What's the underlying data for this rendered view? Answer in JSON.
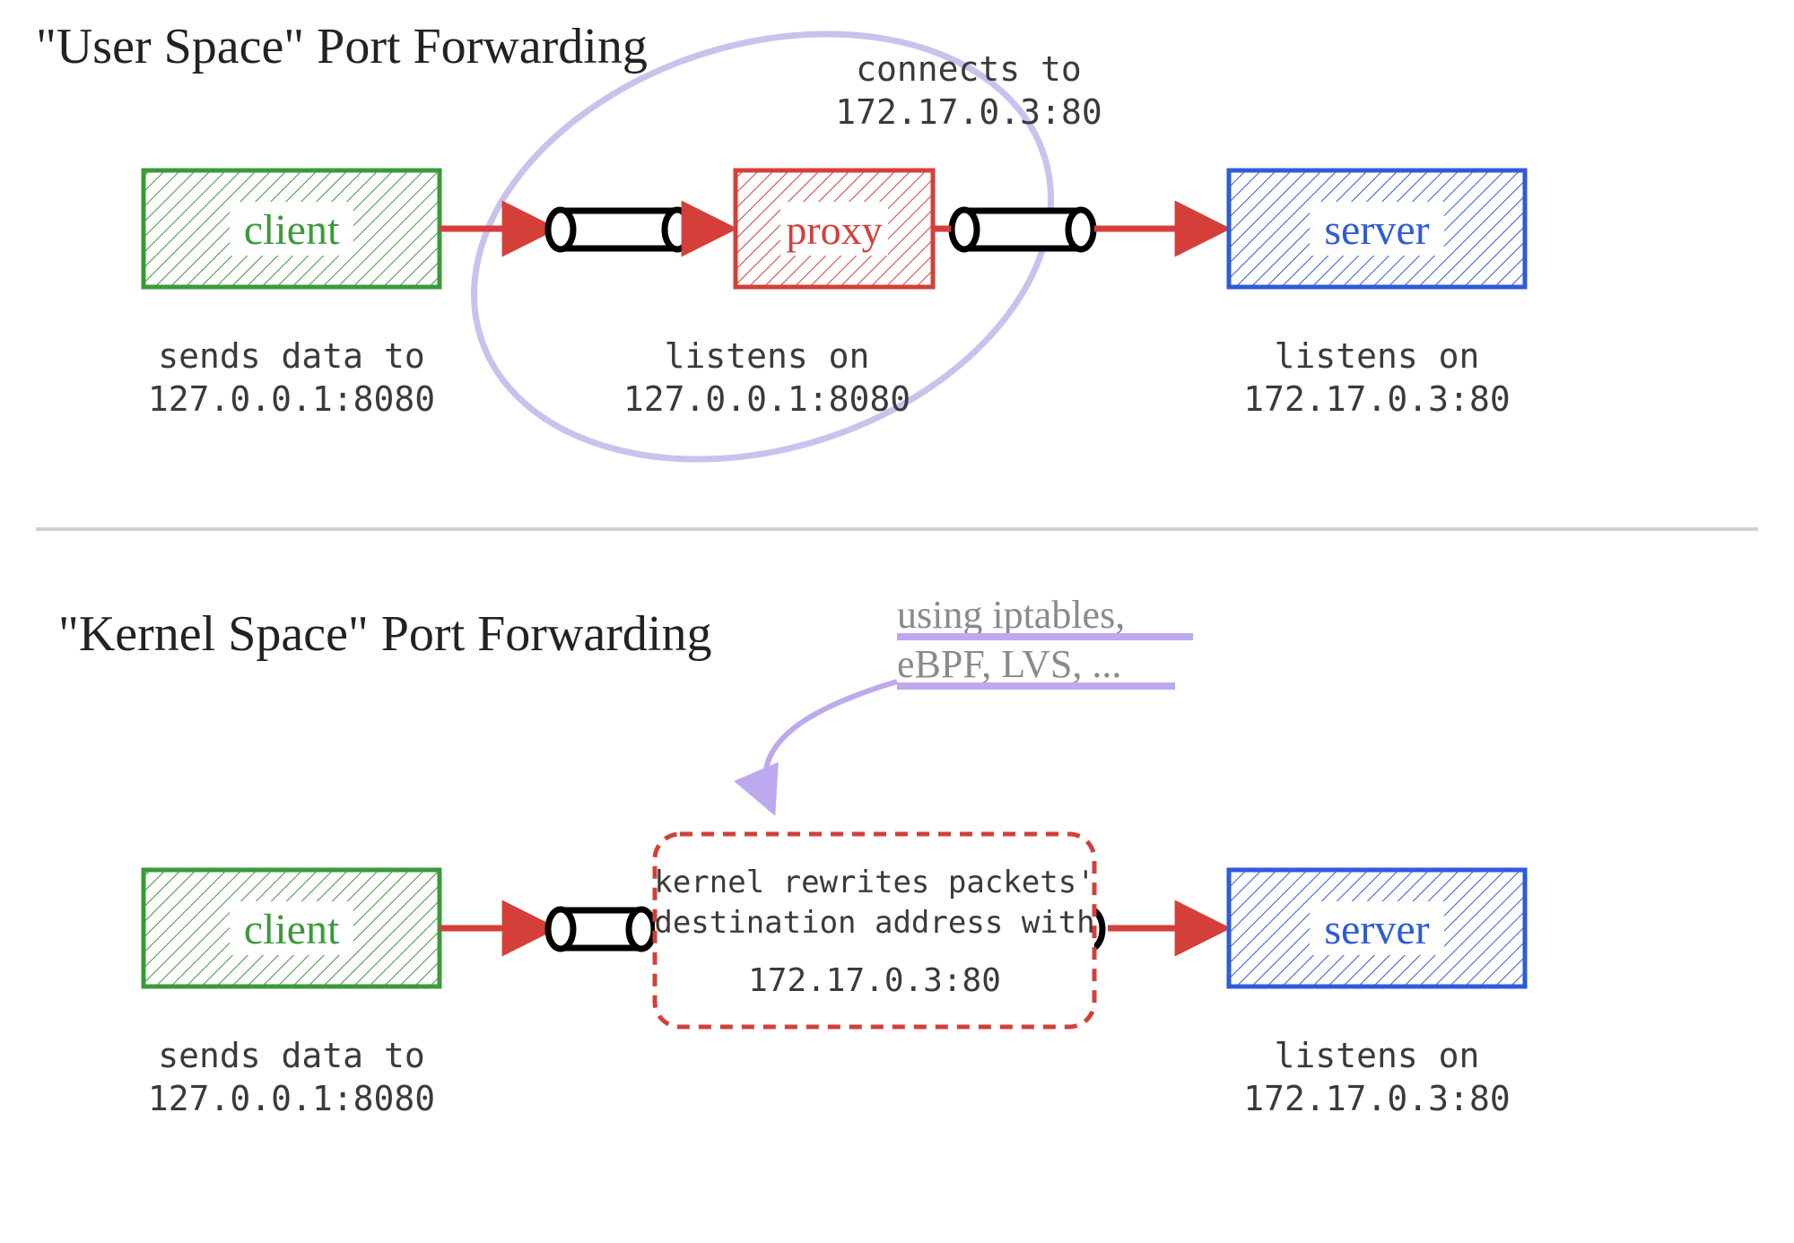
{
  "title_top": "\"User Space\" Port Forwarding",
  "title_bottom": "\"Kernel Space\" Port Forwarding",
  "client": {
    "label": "client",
    "sub1": "sends data to",
    "sub2": "127.0.0.1:8080"
  },
  "proxy": {
    "label": "proxy",
    "listens1": "listens on",
    "listens2": "127.0.0.1:8080",
    "connects1": "connects to",
    "connects2": "172.17.0.3:80"
  },
  "server": {
    "label": "server",
    "listens1": "listens on",
    "listens2": "172.17.0.3:80"
  },
  "kernel": {
    "line1": "kernel rewrites packets'",
    "line2": "destination address with",
    "line3": "172.17.0.3:80"
  },
  "iptables": {
    "line1": "using iptables,",
    "line2": "eBPF, LVS, ..."
  },
  "colors": {
    "green": "#3a9a3a",
    "red": "#d43f3a",
    "blue": "#2e5bd9",
    "arrow": "#d43f3a",
    "grey": "#3a3a3a",
    "lgrey": "#8a8a8a",
    "lilac": "#c9c2ee",
    "lilacLine": "#bda9ef"
  }
}
